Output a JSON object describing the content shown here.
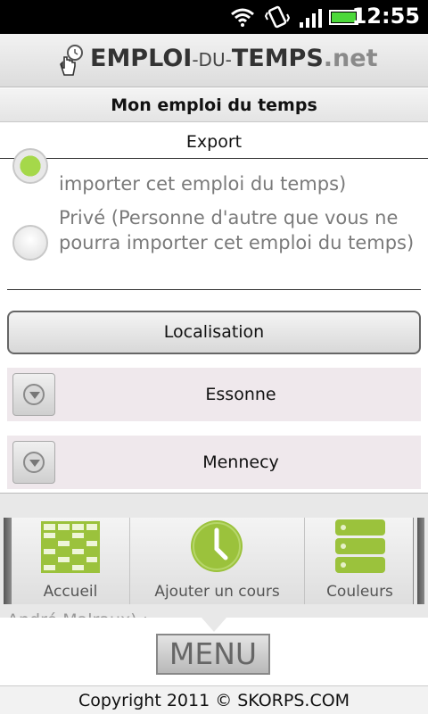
{
  "status_bar": {
    "time": "12:55",
    "icons": [
      "wifi-icon",
      "vibrate-icon",
      "signal-icon",
      "battery-icon"
    ]
  },
  "header": {
    "brand_main": "EMPLOI",
    "brand_dash": "-DU-",
    "brand_temps": "TEMPS",
    "brand_net": ".net",
    "logo_icon": "hand-clock-icon"
  },
  "page": {
    "title": "Mon emploi du temps",
    "section": "Export"
  },
  "visibility": {
    "public_label": "importer cet emploi du temps)",
    "private_label": "Privé (Personne d'autre que vous ne pourra importer cet emploi du temps)"
  },
  "location": {
    "button_label": "Localisation",
    "region": "Essonne",
    "city": "Mennecy"
  },
  "menu": {
    "items": [
      {
        "label": "Accueil",
        "icon": "grid-schedule-icon"
      },
      {
        "label": "Ajouter un cours",
        "icon": "clock-icon"
      },
      {
        "label": "Couleurs",
        "icon": "color-bars-icon"
      }
    ],
    "behind_text": "André Malraux) :",
    "key_label": "MENU"
  },
  "footer": {
    "copyright": "Copyright 2011 © SKORPS.COM"
  },
  "colors": {
    "accent_green": "#9bc23c",
    "status_bar": "#000000"
  }
}
